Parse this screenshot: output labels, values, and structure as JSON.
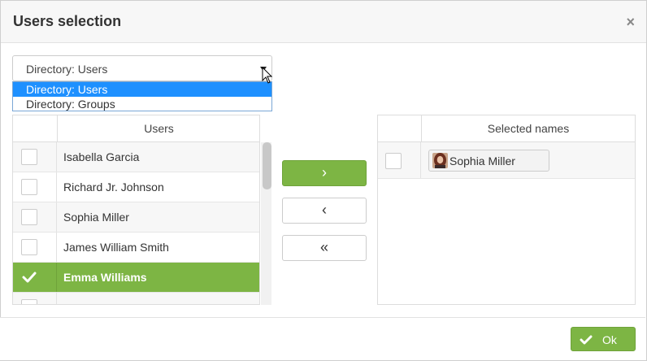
{
  "dialog": {
    "title": "Users selection",
    "close_symbol": "×"
  },
  "directory_select": {
    "selected": "Directory: Users",
    "options": [
      "Directory: Users",
      "Directory: Groups"
    ],
    "active_option_index": 0
  },
  "users_table": {
    "column_header": "Users",
    "rows": [
      {
        "name": "Isabella Garcia",
        "checked": false
      },
      {
        "name": "Richard Jr. Johnson",
        "checked": false
      },
      {
        "name": "Sophia Miller",
        "checked": false
      },
      {
        "name": "James William Smith",
        "checked": false
      },
      {
        "name": "Emma Williams",
        "checked": true
      }
    ]
  },
  "move_buttons": {
    "add": "›",
    "remove": "‹",
    "remove_all": "«"
  },
  "selected_table": {
    "column_header": "Selected names",
    "items": [
      {
        "name": "Sophia Miller",
        "icon": "user-avatar-icon"
      }
    ]
  },
  "footer": {
    "ok_label": "Ok",
    "ok_icon": "check-icon"
  },
  "colors": {
    "accent": "#7db544",
    "dropdown_highlight": "#1e90ff"
  }
}
